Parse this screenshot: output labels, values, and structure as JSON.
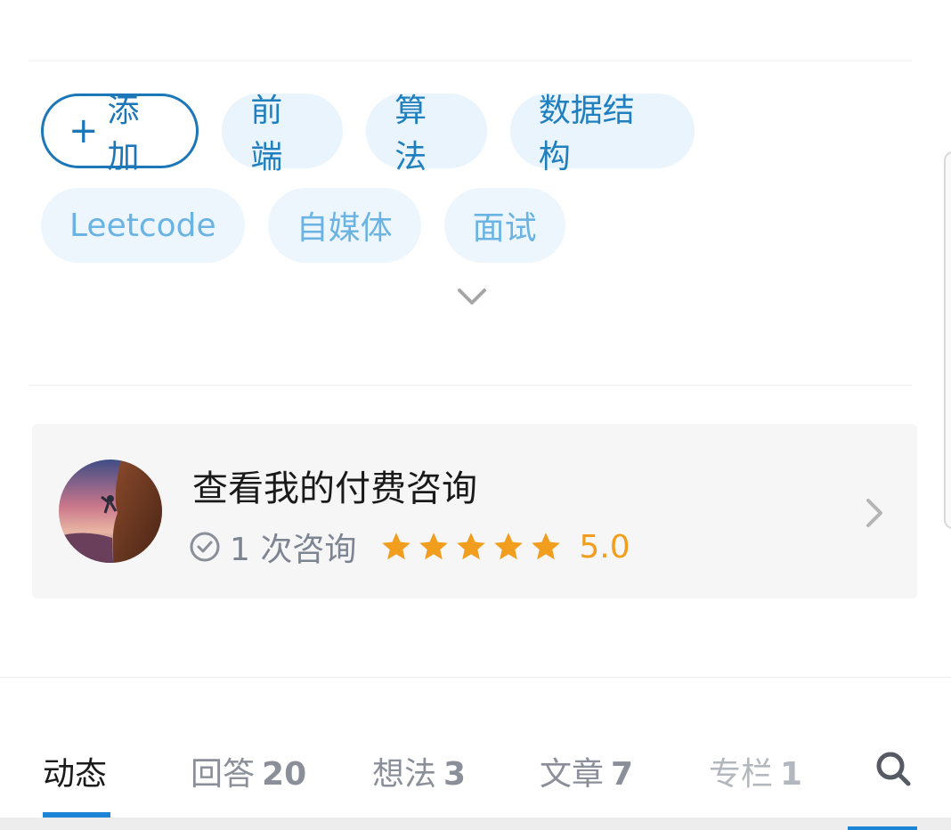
{
  "tags": {
    "add_label": "添加",
    "add_icon": "plus-icon",
    "row1": [
      "前端",
      "算法",
      "数据结构"
    ],
    "row2": [
      "Leetcode",
      "自媒体",
      "面试"
    ],
    "expand_icon": "chevron-down-icon"
  },
  "consult": {
    "title": "查看我的付费咨询",
    "count_text": "1 次咨询",
    "rating_value": "5.0",
    "stars": 5,
    "star_color": "#f19d1e",
    "check_icon": "check-circle-icon",
    "arrow_icon": "chevron-right-icon"
  },
  "tabs": {
    "items": [
      {
        "label": "动态",
        "count": ""
      },
      {
        "label": "回答",
        "count": "20"
      },
      {
        "label": "想法",
        "count": "3"
      },
      {
        "label": "文章",
        "count": "7"
      },
      {
        "label": "专栏",
        "count": "1"
      }
    ],
    "active_index": 0,
    "search_icon": "search-icon",
    "accent_color": "#1c85d6"
  }
}
